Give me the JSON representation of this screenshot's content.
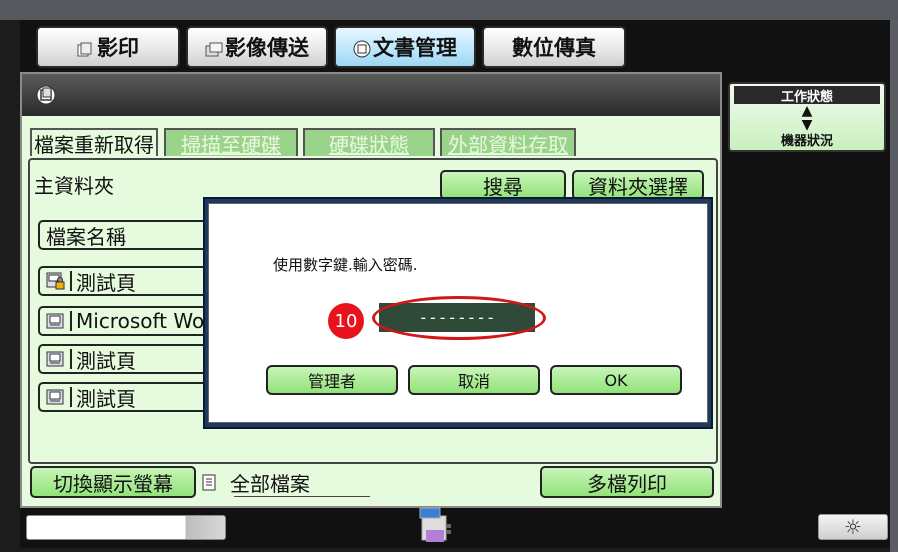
{
  "mode_tabs": [
    {
      "label": "影印",
      "icon": "copy-icon"
    },
    {
      "label": "影像傳送",
      "icon": "image-send-icon"
    },
    {
      "label": "文書管理",
      "icon": "document-filing-icon",
      "active": true
    },
    {
      "label": "數位傳真",
      "icon": ""
    }
  ],
  "sub_tabs": [
    {
      "label": "檔案重新取得",
      "active": true
    },
    {
      "label": "掃描至硬碟"
    },
    {
      "label": "硬碟狀態"
    },
    {
      "label": "外部資料存取"
    }
  ],
  "folder": {
    "title": "主資料夾",
    "search_label": "搜尋",
    "folder_select_label": "資料夾選擇",
    "file_name_header": "檔案名稱"
  },
  "files": [
    {
      "name": "測試頁",
      "icon": "locked-file-icon"
    },
    {
      "name": "Microsoft Wo",
      "icon": "file-icon"
    },
    {
      "name": "測試頁",
      "icon": "file-icon"
    },
    {
      "name": "測試頁",
      "icon": "file-icon"
    }
  ],
  "dialog": {
    "message": "使用數字鍵.輸入密碼.",
    "password_value": "--------",
    "step_badge": "10",
    "admin_label": "管理者",
    "cancel_label": "取消",
    "ok_label": "OK"
  },
  "status": {
    "job_status_label": "工作狀態",
    "arrows": "▲\n▼",
    "machine_status_label": "機器狀況"
  },
  "bottom": {
    "switch_display_label": "切換顯示螢幕",
    "all_files_label": "全部檔案",
    "multi_print_label": "多檔列印"
  },
  "colors": {
    "panel_bg": "#e6fbde",
    "button_green": "#92e27a",
    "active_tab_blue": "#b9e6fb",
    "highlight_red": "#d01818",
    "password_field": "#2f4a38",
    "dialog_border": "#1e3a60"
  },
  "progress_fraction": 0.8
}
